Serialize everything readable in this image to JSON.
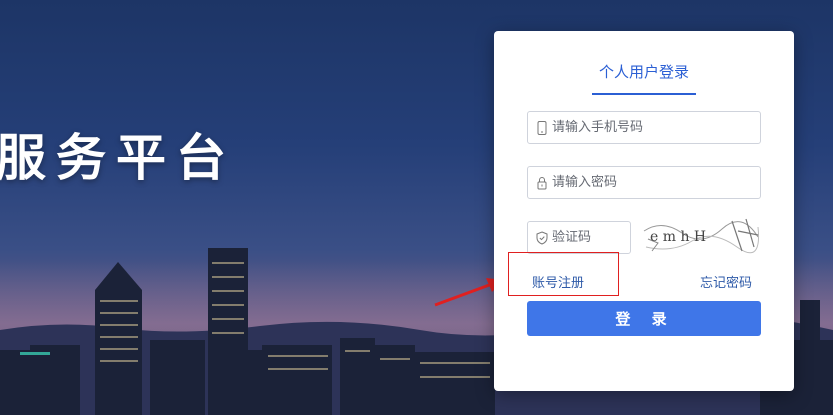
{
  "hero": {
    "title": "服务平台"
  },
  "login": {
    "tab_label": "个人用户登录",
    "phone": {
      "placeholder": "请输入手机号码",
      "icon": "phone-icon"
    },
    "password": {
      "placeholder": "请输入密码",
      "icon": "lock-icon"
    },
    "captcha": {
      "placeholder": "验证码",
      "icon": "shield-icon",
      "image_text": "e m h H"
    },
    "register_label": "账号注册",
    "forgot_label": "忘记密码",
    "submit_label": "登 录"
  },
  "colors": {
    "accent": "#3f76e8",
    "tab": "#2b5fd4",
    "annotation": "#e02020"
  }
}
